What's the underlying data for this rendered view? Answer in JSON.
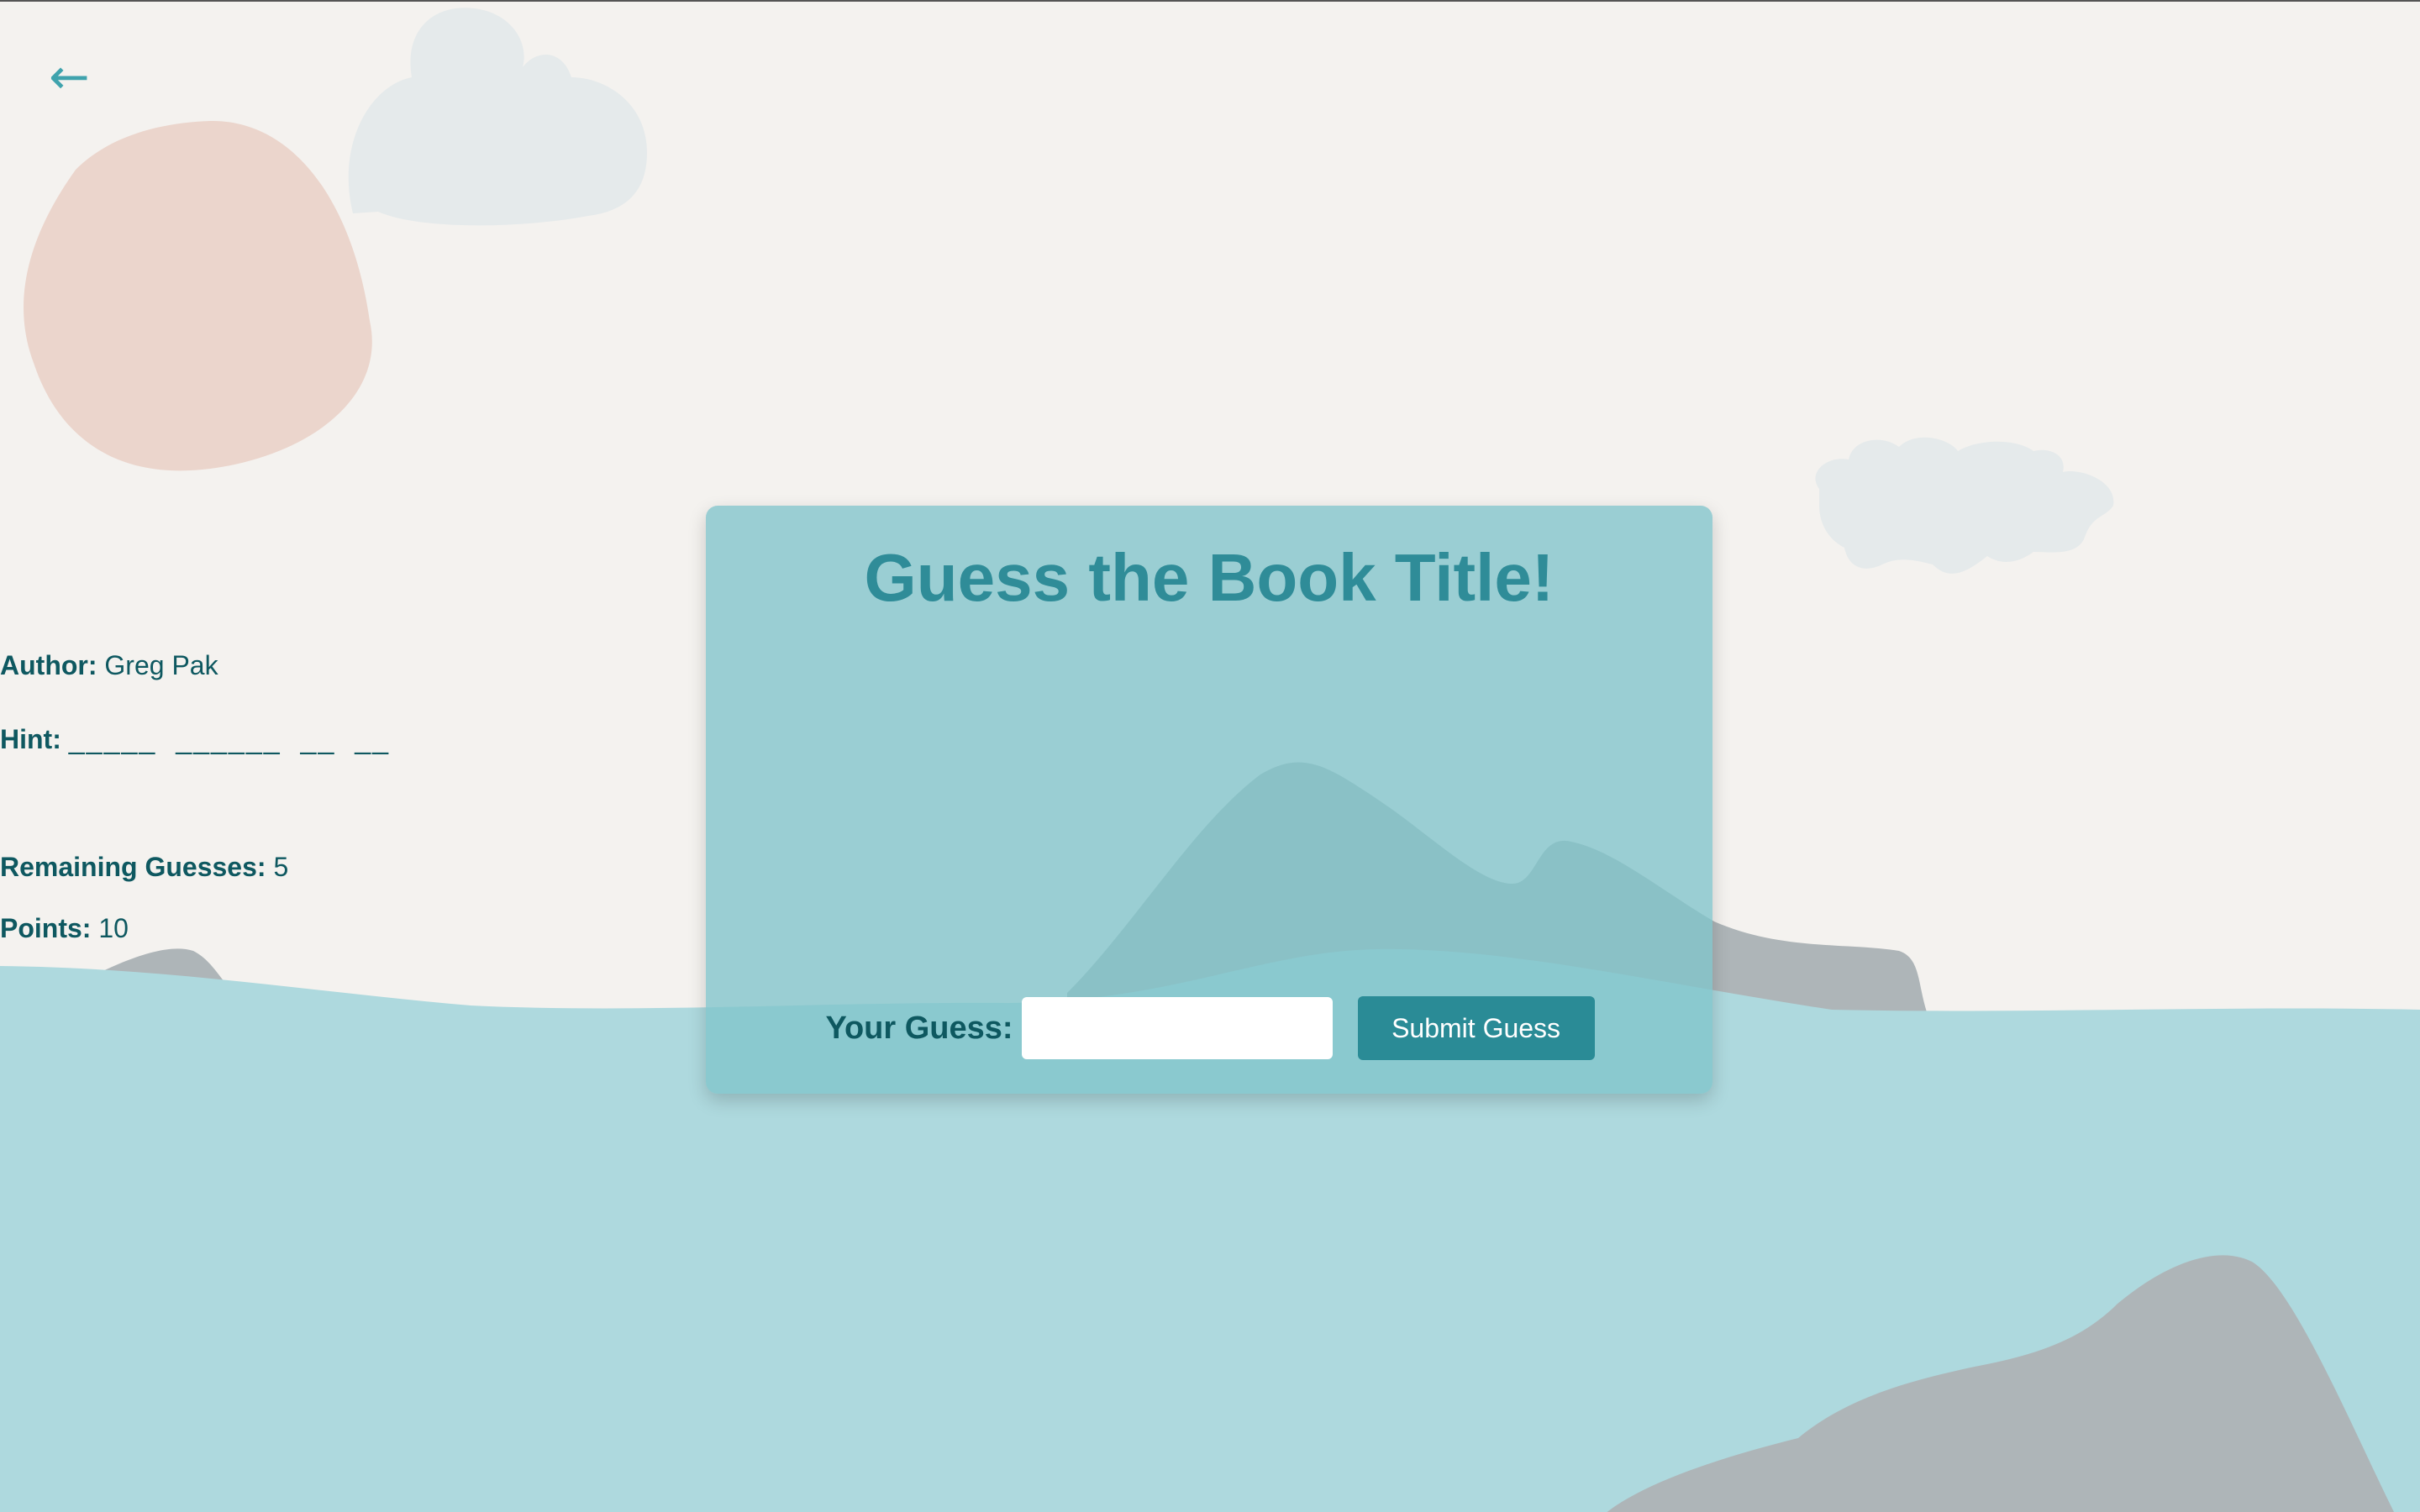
{
  "nav": {
    "back_icon": "←"
  },
  "game": {
    "title": "Guess the Book Title!",
    "author_label": "Author:",
    "author_value": "Greg Pak",
    "hint_label": "Hint:",
    "hint_value": "_____  ______  __  __",
    "remaining_label": "Remaining Guesses:",
    "remaining_value": "5",
    "points_label": "Points:",
    "points_value": "10",
    "guess_label": "Your Guess:",
    "guess_input_value": "",
    "guess_input_placeholder": "",
    "submit_label": "Submit Guess"
  },
  "colors": {
    "background": "#f4f2ef",
    "water": "#aed9de",
    "card": "#80c4ca",
    "title": "#2f8c98",
    "accent_button": "#2a8b96",
    "text_dark": "#0e5860",
    "sun": "#ebd5cc",
    "cloud": "#e5eaeb",
    "mountain": "#aeb5b8"
  }
}
